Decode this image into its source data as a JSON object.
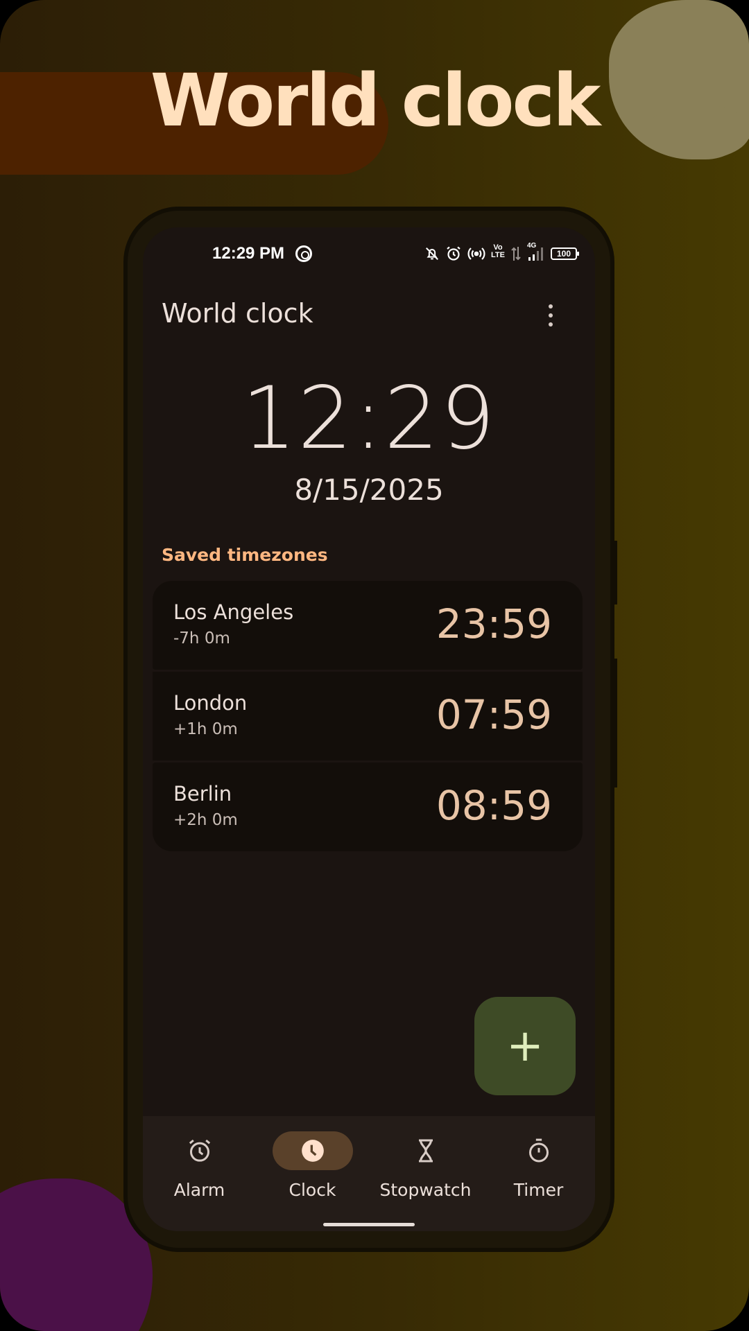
{
  "promo": {
    "title": "World clock"
  },
  "statusbar": {
    "time": "12:29 PM",
    "network_label_top": "Vo",
    "network_label_bottom": "LTE",
    "signal_label": "4G",
    "battery": "100"
  },
  "app_bar": {
    "title": "World clock",
    "more_icon": "more-vert-icon"
  },
  "clock": {
    "time": "12:29",
    "date": "8/15/2025"
  },
  "saved": {
    "header": "Saved timezones",
    "zones": [
      {
        "city": "Los Angeles",
        "offset": "-7h 0m",
        "time": "23:59"
      },
      {
        "city": "London",
        "offset": "+1h 0m",
        "time": "07:59"
      },
      {
        "city": "Berlin",
        "offset": "+2h 0m",
        "time": "08:59"
      }
    ]
  },
  "fab": {
    "label": "+"
  },
  "nav": {
    "items": [
      {
        "label": "Alarm",
        "icon": "alarm-icon",
        "active": false
      },
      {
        "label": "Clock",
        "icon": "clock-icon",
        "active": true
      },
      {
        "label": "Stopwatch",
        "icon": "hourglass-icon",
        "active": false
      },
      {
        "label": "Timer",
        "icon": "timer-icon",
        "active": false
      }
    ]
  },
  "colors": {
    "accent": "#ffb781",
    "fab_bg": "#3e4b26",
    "active_nav_pill": "#5a412a",
    "zone_time": "#e8c4a6",
    "promo_title": "#ffe0bd"
  }
}
